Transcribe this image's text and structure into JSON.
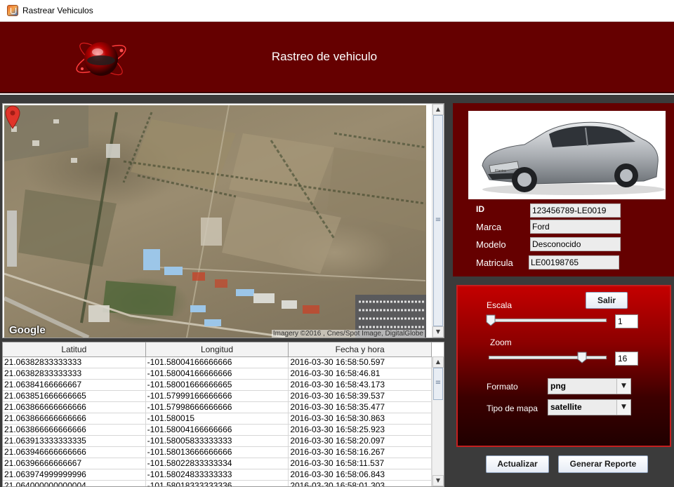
{
  "window": {
    "title": "Rastrear Vehiculos"
  },
  "header": {
    "title": "Rastreo de vehiculo"
  },
  "map": {
    "logo_text": "Google",
    "attribution": "Imagery ©2016 , Cnes/Spot Image, DigitalGlobe",
    "map_type": "satellite"
  },
  "table": {
    "columns": [
      "Latitud",
      "Longitud",
      "Fecha y hora"
    ],
    "rows": [
      [
        "21.06382833333333",
        "-101.58004166666666",
        "2016-03-30 16:58:50.597"
      ],
      [
        "21.06382833333333",
        "-101.58004166666666",
        "2016-03-30 16:58:46.81"
      ],
      [
        "21.06384166666667",
        "-101.58001666666665",
        "2016-03-30 16:58:43.173"
      ],
      [
        "21.063851666666665",
        "-101.57999166666666",
        "2016-03-30 16:58:39.537"
      ],
      [
        "21.063866666666666",
        "-101.57998666666666",
        "2016-03-30 16:58:35.477"
      ],
      [
        "21.063866666666666",
        "-101.580015",
        "2016-03-30 16:58:30.863"
      ],
      [
        "21.063866666666666",
        "-101.58004166666666",
        "2016-03-30 16:58:25.923"
      ],
      [
        "21.063913333333335",
        "-101.58005833333333",
        "2016-03-30 16:58:20.097"
      ],
      [
        "21.063946666666666",
        "-101.58013666666666",
        "2016-03-30 16:58:16.267"
      ],
      [
        "21.06396666666667",
        "-101.58022833333334",
        "2016-03-30 16:58:11.537"
      ],
      [
        "21.063974999999996",
        "-101.58024833333333",
        "2016-03-30 16:58:06.843"
      ],
      [
        "21.064000000000004",
        "-101.58018333333336",
        "2016-03-30 16:58:01.303"
      ]
    ]
  },
  "vehicle": {
    "id_label": "ID",
    "id_value": "123456789-LE0019",
    "marca_label": "Marca",
    "marca_value": "Ford",
    "modelo_label": "Modelo",
    "modelo_value": "Desconocido",
    "matricula_label": "Matricula",
    "matricula_value": "LE00198765"
  },
  "controls": {
    "salir_label": "Salir",
    "escala_label": "Escala",
    "escala_value": "1",
    "escala_fraction": 0.0,
    "zoom_label": "Zoom",
    "zoom_value": "16",
    "zoom_fraction": 0.8,
    "formato_label": "Formato",
    "formato_value": "png",
    "tipo_label": "Tipo de mapa",
    "tipo_value": "satellite",
    "actualizar_label": "Actualizar",
    "reporte_label": "Generar Reporte"
  },
  "colors": {
    "header_bg": "#650000",
    "panel_bg": "#650000",
    "control_top": "#c40000",
    "marker": "#e0342a"
  }
}
